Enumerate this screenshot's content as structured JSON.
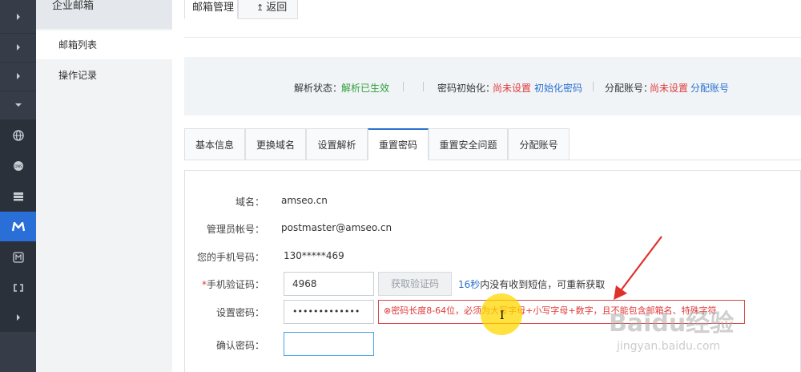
{
  "sidebar": {
    "title": "企业邮箱",
    "items": [
      {
        "label": "邮箱列表",
        "active": true
      },
      {
        "label": "操作记录",
        "active": false
      }
    ]
  },
  "rail_icons": [
    "chevron-right-icon",
    "chevron-right-icon",
    "chevron-right-icon",
    "chevron-down-icon",
    "globe-icon",
    "dns-icon",
    "server-icon",
    "mail-m-icon",
    "mail-box-icon",
    "link-icon",
    "chevron-right-icon"
  ],
  "top_tabs": {
    "active": "邮箱管理",
    "back": "返回",
    "back_icon": "↥"
  },
  "status": {
    "parse_label": "解析状态：",
    "parse_value": "解析已生效",
    "pwd_init_label": "密码初始化：",
    "pwd_init_value": "尚未设置",
    "pwd_init_link": "初始化密码",
    "assign_label": "分配账号：",
    "assign_value": "尚未设置",
    "assign_link": "分配账号"
  },
  "tabs": [
    "基本信息",
    "更换域名",
    "设置解析",
    "重置密码",
    "重置安全问题",
    "分配账号"
  ],
  "active_tab": "重置密码",
  "form": {
    "domain_label": "域名：",
    "domain_value": "amseo.cn",
    "admin_label": "管理员帐号：",
    "admin_value": "postmaster@amseo.cn",
    "phone_label": "您的手机号码：",
    "phone_value": "130*****469",
    "code_required_mark": "*",
    "code_label": "手机验证码：",
    "code_value": "4968",
    "get_code_button": "获取验证码",
    "hint_seconds": "16秒",
    "hint_text": "内没有收到短信，可重新获取",
    "set_pwd_label": "设置密码：",
    "set_pwd_value": "•••••••••••••",
    "error_text": "⊗密码长度8-64位，必须为大写字母+小写字母+数字，且不能包含邮箱名、特殊字符",
    "confirm_label": "确认密码："
  },
  "watermark": {
    "main": "Baidu经验",
    "sub": "jingyan.baidu.com"
  },
  "colors": {
    "accent": "#2a70d0",
    "success": "#2f9e3b",
    "error": "#e03a3a",
    "rail": "#363d49"
  }
}
